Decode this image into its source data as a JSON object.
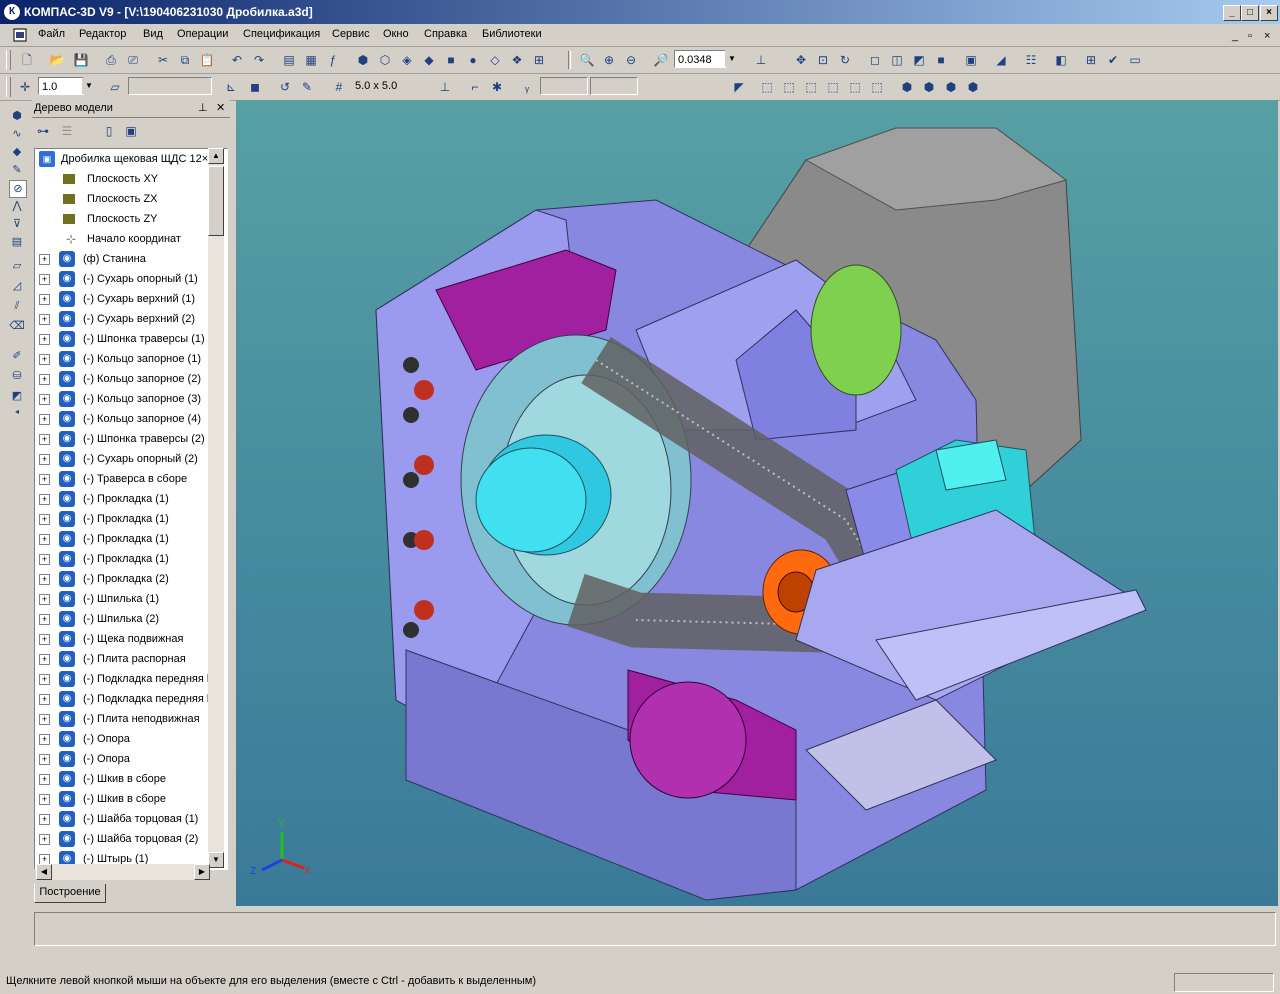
{
  "window": {
    "title": "КОМПАС-3D V9 - [V:\\190406231030 Дробилка.a3d]"
  },
  "menu": [
    "Файл",
    "Редактор",
    "Вид",
    "Операции",
    "Спецификация",
    "Сервис",
    "Окно",
    "Справка",
    "Библиотеки"
  ],
  "toolbar": {
    "zoom_value": "0.0348",
    "scale_value": "1.0",
    "grid_value": "5.0 x 5.0"
  },
  "tree_panel": {
    "title": "Дерево модели",
    "root": "Дробилка щековая ЩДС 12×",
    "items": [
      {
        "label": "Плоскость XY",
        "kind": "plane"
      },
      {
        "label": "Плоскость ZX",
        "kind": "plane"
      },
      {
        "label": "Плоскость ZY",
        "kind": "plane"
      },
      {
        "label": "Начало координат",
        "kind": "axis"
      },
      {
        "label": "(ф) Станина",
        "kind": "part"
      },
      {
        "label": "(-) Сухарь опорный (1)",
        "kind": "part"
      },
      {
        "label": "(-) Сухарь верхний (1)",
        "kind": "part"
      },
      {
        "label": "(-) Сухарь верхний (2)",
        "kind": "part"
      },
      {
        "label": "(-) Шпонка траверсы (1)",
        "kind": "part"
      },
      {
        "label": "(-) Кольцо запорное (1)",
        "kind": "part"
      },
      {
        "label": "(-) Кольцо запорное (2)",
        "kind": "part"
      },
      {
        "label": "(-) Кольцо запорное (3)",
        "kind": "part"
      },
      {
        "label": "(-) Кольцо запорное (4)",
        "kind": "part"
      },
      {
        "label": "(-) Шпонка траверсы (2)",
        "kind": "part"
      },
      {
        "label": "(-) Сухарь опорный (2)",
        "kind": "part"
      },
      {
        "label": "(-) Траверса в сборе",
        "kind": "asm"
      },
      {
        "label": "(-) Прокладка (1)",
        "kind": "part"
      },
      {
        "label": "(-) Прокладка  (1)",
        "kind": "part"
      },
      {
        "label": "(-) Прокладка (1)",
        "kind": "part"
      },
      {
        "label": "(-) Прокладка (1)",
        "kind": "part"
      },
      {
        "label": "(-) Прокладка (2)",
        "kind": "part"
      },
      {
        "label": "(-) Шпилька  (1)",
        "kind": "part"
      },
      {
        "label": "(-) Шпилька  (2)",
        "kind": "part"
      },
      {
        "label": "(-) Щека подвижная",
        "kind": "asm"
      },
      {
        "label": "(-) Плита распорная",
        "kind": "part"
      },
      {
        "label": "(-) Подкладка передняя l",
        "kind": "part"
      },
      {
        "label": "(-) Подкладка передняя l",
        "kind": "part"
      },
      {
        "label": "(-) Плита неподвижная",
        "kind": "part"
      },
      {
        "label": "(-) Опора",
        "kind": "part"
      },
      {
        "label": "(-) Опора",
        "kind": "part"
      },
      {
        "label": "(-) Шкив в сборе",
        "kind": "asm"
      },
      {
        "label": "(-) Шкив в сборе",
        "kind": "asm"
      },
      {
        "label": "(-) Шайба торцовая (1)",
        "kind": "part"
      },
      {
        "label": "(-) Шайба торцовая (2)",
        "kind": "part"
      },
      {
        "label": "(-) Штырь (1)",
        "kind": "part"
      }
    ],
    "tab": "Построение"
  },
  "axes": {
    "x": "X",
    "y": "Y",
    "z": "Z"
  },
  "status": {
    "hint": "Щелкните левой кнопкой мыши на объекте для его выделения (вместе с Ctrl - добавить к выделенным)"
  }
}
